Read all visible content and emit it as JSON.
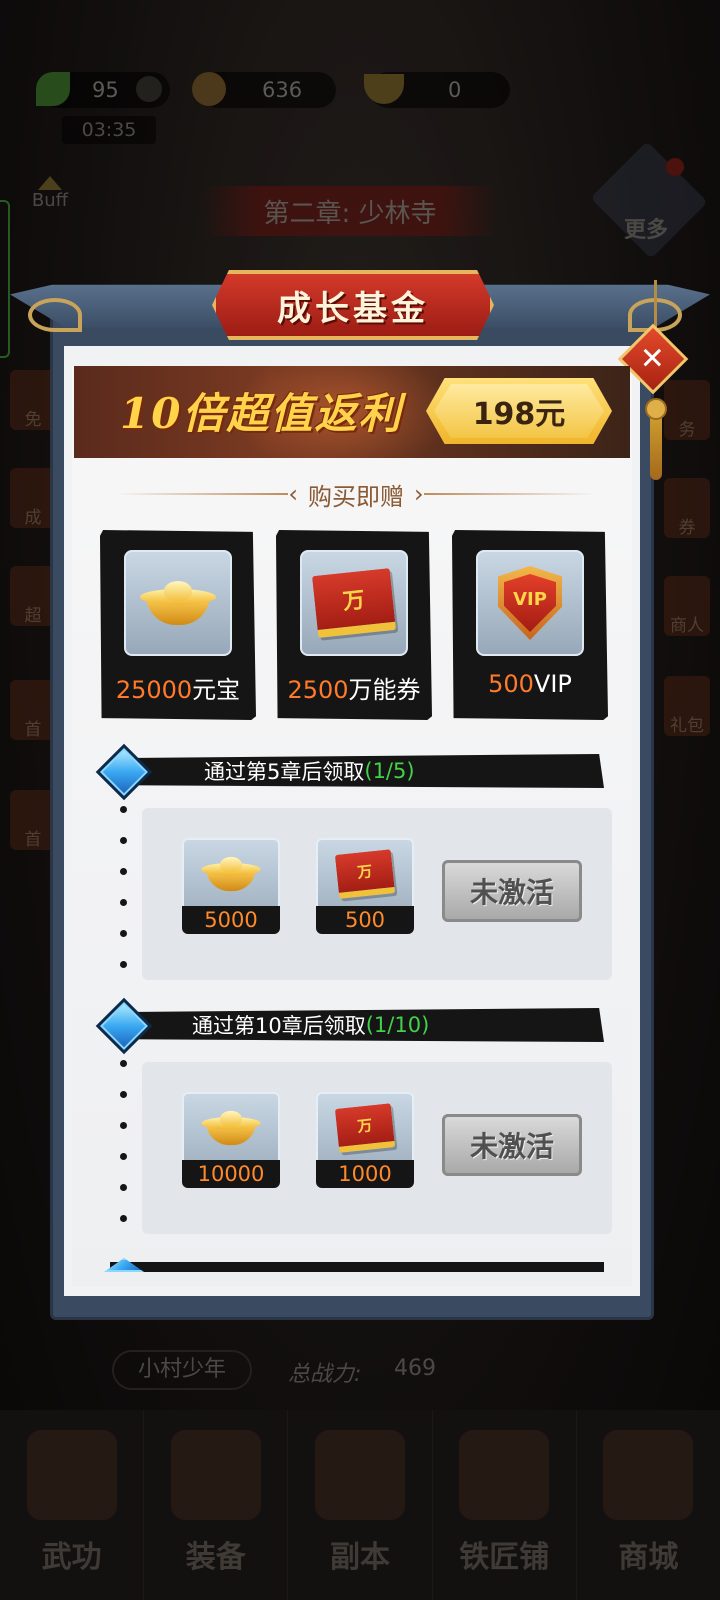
{
  "hud": {
    "stamina": "95",
    "timer": "03:35",
    "coins": "636",
    "ingots": "0",
    "buff_label": "Buff",
    "chapter": "第二章: 少林寺",
    "more_label": "更多"
  },
  "side_left": [
    "免",
    "成",
    "超",
    "首",
    "首"
  ],
  "side_right": [
    "务",
    "券",
    "商人",
    "礼包"
  ],
  "player": {
    "name": "小村少年",
    "power_label": "总战力:",
    "power": "469"
  },
  "nav": [
    "武功",
    "装备",
    "副本",
    "铁匠铺",
    "商城"
  ],
  "modal": {
    "title": "成长基金",
    "promo_text": "10倍超值返利",
    "price": "198元",
    "gift_heading": "购买即赠",
    "gifts": [
      {
        "icon": "gold-ingot-icon",
        "amount": "25000",
        "unit": "元宝"
      },
      {
        "icon": "voucher-icon",
        "amount": "2500",
        "unit": "万能券"
      },
      {
        "icon": "vip-shield-icon",
        "amount": "500",
        "unit": "VIP"
      }
    ],
    "tiers": [
      {
        "label": "通过第5章后领取",
        "progress": "(1/5)",
        "rewards": [
          "5000",
          "500"
        ],
        "button": "未激活"
      },
      {
        "label": "通过第10章后领取",
        "progress": "(1/10)",
        "rewards": [
          "10000",
          "1000"
        ],
        "button": "未激活"
      }
    ],
    "voucher_glyph": "万",
    "vip_glyph": "VIP",
    "close_glyph": "✕"
  },
  "colors": {
    "accent_orange": "#ff7a2a",
    "progress_green": "#43d14a",
    "title_red": "#c2281c",
    "gold": "#f3c545"
  }
}
